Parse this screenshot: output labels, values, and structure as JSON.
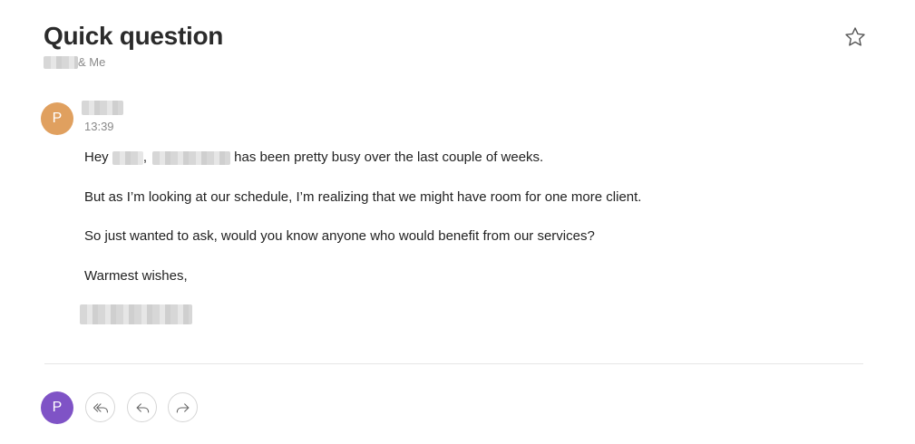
{
  "email": {
    "subject": "Quick question",
    "participants_suffix": "& Me",
    "sender_initial": "P",
    "time": "13:39",
    "body": {
      "line1_prefix": "Hey ",
      "line1_comma": ",",
      "line1_rest": " has been pretty busy over the last couple of weeks.",
      "line2": "But as I’m looking at our schedule, I’m realizing that we might have room for one more client.",
      "line3": "So just wanted to ask, would you know anyone who would benefit from our services?",
      "line4": "Warmest wishes,"
    }
  },
  "composer": {
    "avatar_initial": "P"
  },
  "icons": {
    "star": "star-outline-icon",
    "reply_all": "reply-all-icon",
    "reply": "reply-icon",
    "forward": "forward-icon"
  },
  "colors": {
    "sender_avatar": "#e0a05f",
    "me_avatar": "#7f53c6",
    "muted_text": "#8a8a8a",
    "divider": "#e5e5e5"
  }
}
